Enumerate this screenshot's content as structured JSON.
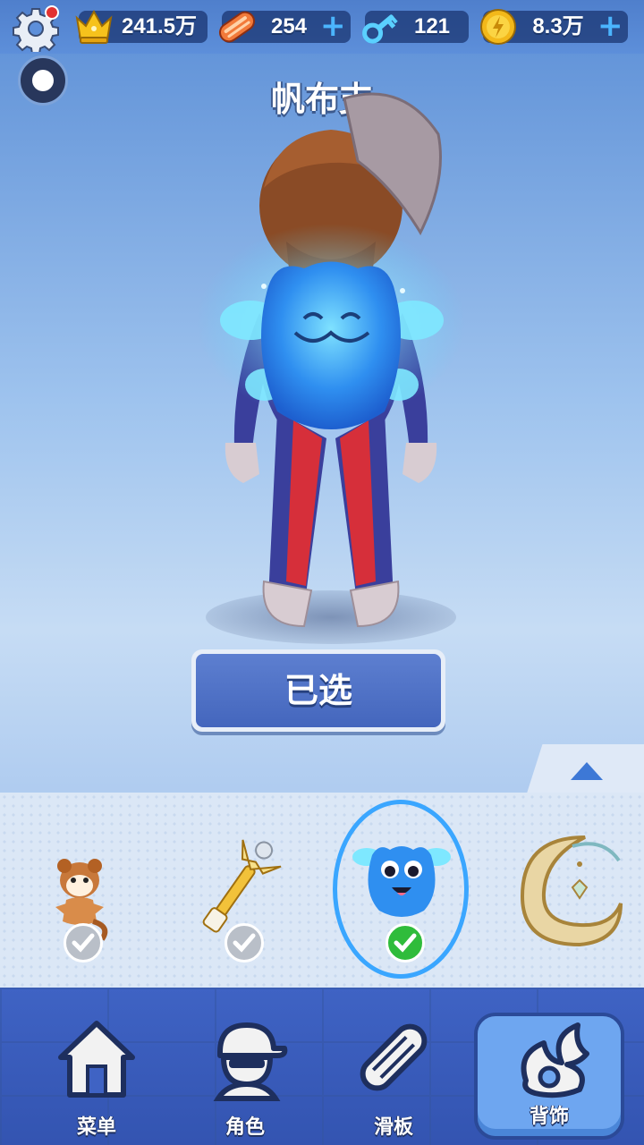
{
  "topbar": {
    "stats": [
      {
        "id": "crown",
        "value": "241.5万",
        "icon": "crown-icon",
        "has_plus": false
      },
      {
        "id": "skateboard",
        "value": "254",
        "icon": "skateboard-ticket-icon",
        "has_plus": true
      },
      {
        "id": "key",
        "value": "121",
        "icon": "key-icon",
        "has_plus": false
      },
      {
        "id": "coin",
        "value": "8.3万",
        "icon": "coin-icon",
        "has_plus": true
      }
    ],
    "plus_label": "+",
    "settings_has_notification": true
  },
  "item_name": "帆布支",
  "select_button_label": "已选",
  "items": [
    {
      "name": "hamster-pet",
      "owned": true,
      "selected": false
    },
    {
      "name": "golden-scepter",
      "owned": true,
      "selected": false
    },
    {
      "name": "blue-slime-backpack",
      "owned": true,
      "selected": true
    },
    {
      "name": "crescent-moon-ring",
      "owned": false,
      "selected": false
    }
  ],
  "nav": {
    "items": [
      {
        "label": "菜单",
        "icon": "house-icon",
        "active": false
      },
      {
        "label": "角色",
        "icon": "character-icon",
        "active": false
      },
      {
        "label": "滑板",
        "icon": "skateboard-icon",
        "active": false
      },
      {
        "label": "背饰",
        "icon": "wing-icon",
        "active": true
      }
    ]
  },
  "colors": {
    "accent": "#3aa6ff",
    "check_on": "#2fbc3b",
    "check_off": "#b9bfc8",
    "nav_bg": "#3f63c4",
    "button_bg": "#4a6cc4"
  }
}
